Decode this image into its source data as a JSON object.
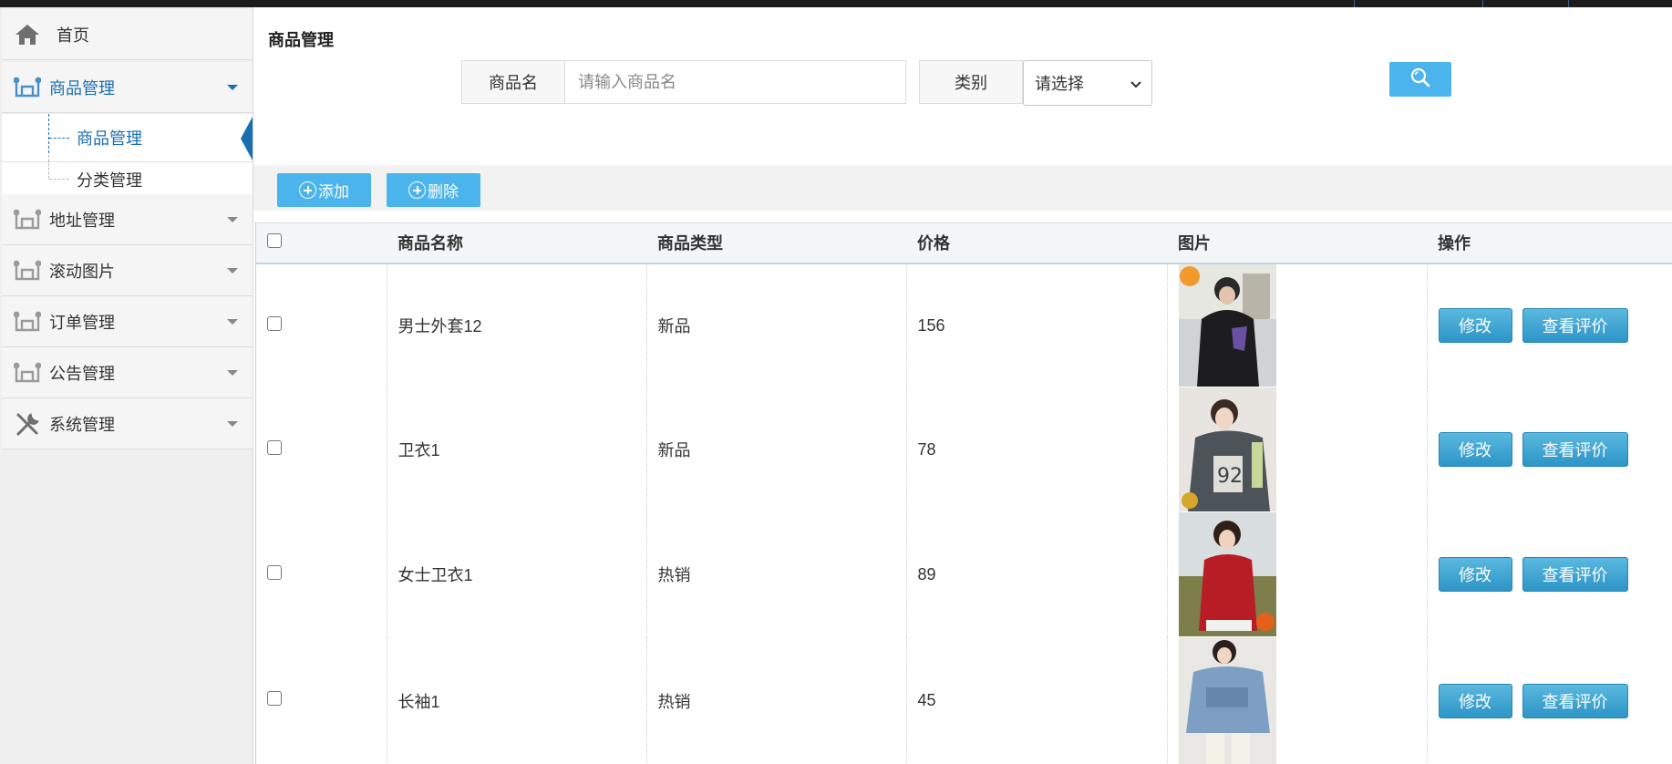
{
  "sidebar": {
    "home": {
      "label": "首页",
      "icon": "home-icon"
    },
    "groups": [
      {
        "label": "商品管理",
        "icon": "category-icon",
        "active": true
      },
      {
        "label": "地址管理",
        "icon": "category-icon"
      },
      {
        "label": "滚动图片",
        "icon": "category-icon"
      },
      {
        "label": "订单管理",
        "icon": "category-icon"
      },
      {
        "label": "公告管理",
        "icon": "category-icon"
      },
      {
        "label": "系统管理",
        "icon": "tools-icon"
      }
    ],
    "sub_items": [
      {
        "label": "商品管理",
        "active": true
      },
      {
        "label": "分类管理"
      }
    ]
  },
  "main": {
    "title": "商品管理",
    "search": {
      "name_label": "商品名",
      "name_placeholder": "请输入商品名",
      "name_value": "",
      "category_label": "类别",
      "category_selected": "请选择",
      "search_icon": "search-icon"
    },
    "toolbar": {
      "add_label": "添加",
      "delete_label": "删除"
    },
    "table": {
      "headers": [
        "商品名称",
        "商品类型",
        "价格",
        "图片",
        "操作"
      ],
      "rows": [
        {
          "name": "男士外套12",
          "type": "新品",
          "price": "156",
          "image": "black-hooded-jacket-photo"
        },
        {
          "name": "卫衣1",
          "type": "新品",
          "price": "78",
          "image": "grey-sweatshirt-photo"
        },
        {
          "name": "女士卫衣1",
          "type": "热销",
          "price": "89",
          "image": "red-hoodie-photo"
        },
        {
          "name": "长袖1",
          "type": "热销",
          "price": "45",
          "image": "blue-longsleeve-photo"
        }
      ],
      "edit_label": "修改",
      "review_label": "查看评价"
    }
  },
  "colors": {
    "accent": "#4cb4ec",
    "nav_active": "#1a6fb0",
    "action_button": "#2d95c7"
  }
}
